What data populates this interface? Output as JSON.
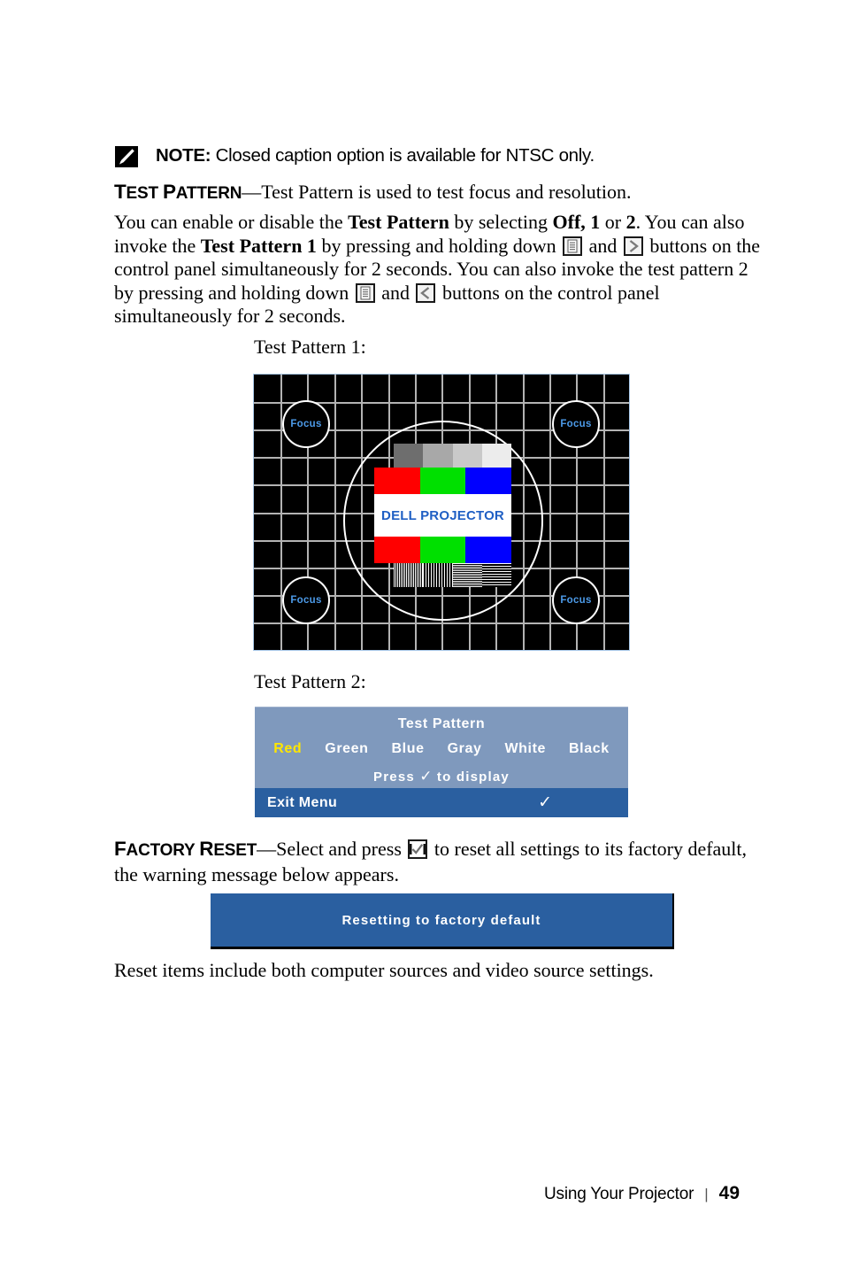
{
  "note": {
    "icon": "note-pencil-icon",
    "label": "NOTE:",
    "text": " Closed caption option is available for NTSC only."
  },
  "test_pattern_section": {
    "term_cap": "T",
    "term_rest": "EST ",
    "term_cap2": "P",
    "term_rest2": "ATTERN",
    "term_full": "TEST PATTERN",
    "term_dash_text": "—Test Pattern is used to test focus and resolution.",
    "paragraph_part1": "You can enable or disable the ",
    "paragraph_bold1": "Test Pattern",
    "paragraph_part2": " by selecting ",
    "paragraph_bold2": "Off, 1",
    "paragraph_part3": " or ",
    "paragraph_bold3": "2",
    "paragraph_part4": ". You can also invoke the ",
    "paragraph_bold4": "Test Pattern 1",
    "paragraph_part5": " by pressing and holding down ",
    "paragraph_part6": " and ",
    "paragraph_part7": " buttons on the control panel simultaneously for 2 seconds. You can also invoke the test pattern 2 by pressing and holding down ",
    "paragraph_part8": " and ",
    "paragraph_part9": " buttons on the control panel simultaneously for 2 seconds.",
    "icons": {
      "menu": "menu-icon",
      "right": "right-arrow-icon",
      "left": "left-arrow-icon"
    },
    "caption_1": "Test Pattern 1:",
    "caption_2": "Test Pattern 2:"
  },
  "test_pattern_image": {
    "focus_labels": [
      "Focus",
      "Focus",
      "Focus",
      "Focus"
    ],
    "center_text": "DELL PROJECTOR",
    "grid_columns": 14,
    "grid_rows": 10,
    "grayscale_bars": [
      "#6e6e6e",
      "#a8a8a8",
      "#c9c9c9",
      "#ececec"
    ],
    "rgb_bars": [
      "#ff0000",
      "#00e000",
      "#0000ff"
    ],
    "line_patterns": [
      "vertical-fine",
      "vertical-medium",
      "horizontal-fine",
      "horizontal-medium"
    ],
    "colors": {
      "background": "#000000",
      "grid_line": "#b3b3b3",
      "circle": "#ffffff",
      "focus_text": "#4c9ae8",
      "center_text": "#1f5fc4",
      "border": "#a8c8e8"
    }
  },
  "osd_menu": {
    "title": "Test Pattern",
    "options": [
      {
        "label": "Red",
        "selected": true
      },
      {
        "label": "Green",
        "selected": false
      },
      {
        "label": "Blue",
        "selected": false
      },
      {
        "label": "Gray",
        "selected": false
      },
      {
        "label": "White",
        "selected": false
      },
      {
        "label": "Black",
        "selected": false
      }
    ],
    "press_prefix": "Press",
    "press_check": "✓",
    "press_suffix": "to display",
    "exit_label": "Exit Menu",
    "exit_check": "✓",
    "colors": {
      "body": "#7f99bd",
      "bar": "#2a5fa0",
      "selected_text": "#ffe600",
      "text": "#ffffff"
    }
  },
  "factory_reset_section": {
    "term_full": "FACTORY RESET",
    "term_text_part1": "—Select and press ",
    "term_text_part2": " to reset all settings to its factory default, the warning message below appears.",
    "check_icon": "check-button-icon",
    "banner_text": "Resetting to factory default",
    "banner_color": "#2a5fa0",
    "closing_paragraph": "Reset items include both computer sources and video source settings."
  },
  "footer": {
    "title": "Using Your Projector",
    "separator": "|",
    "page_number": "49"
  }
}
